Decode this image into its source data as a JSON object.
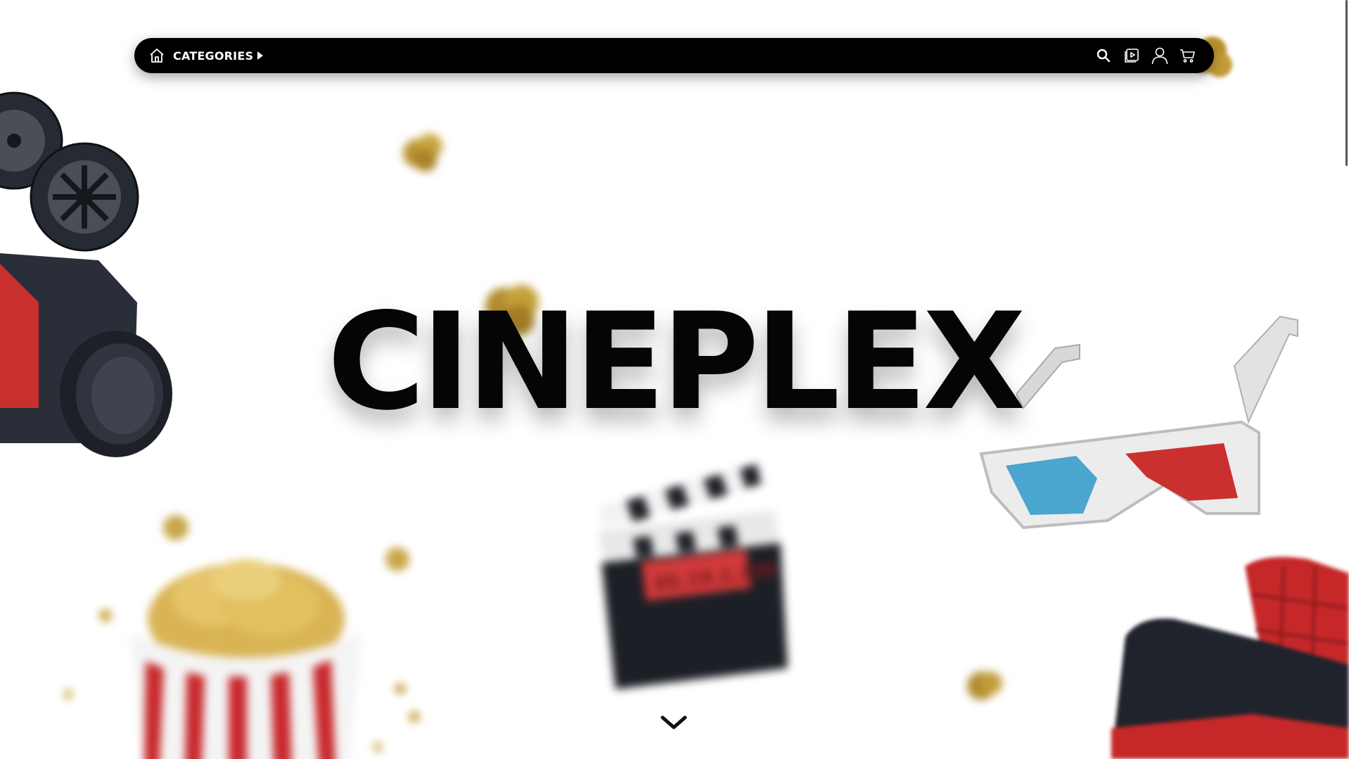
{
  "nav": {
    "categories_label": "CATEGORIES",
    "home_icon": "home-icon",
    "right_icons": [
      "search-icon",
      "play-library-icon",
      "user-icon",
      "cart-icon"
    ]
  },
  "hero": {
    "title": "CINEPLEX",
    "clapper_text": "05.19.1.200"
  },
  "colors": {
    "navbar": "#000000",
    "title": "#050505",
    "background": "#ffffff",
    "accent_red": "#c9272a",
    "accent_blue": "#3aa0cf",
    "popcorn": "#c8a43c"
  }
}
